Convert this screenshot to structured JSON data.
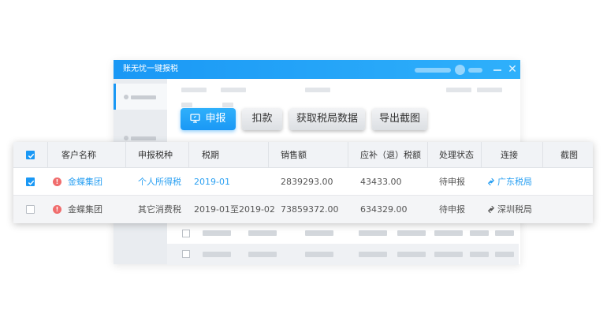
{
  "window": {
    "title": "账无忧一键报税"
  },
  "toolbar": {
    "declare_label": "申报",
    "deduct_label": "扣款",
    "fetch_label": "获取税局数据",
    "export_label": "导出截图"
  },
  "table": {
    "columns": {
      "customer": "客户名称",
      "tax_type": "申报税种",
      "period": "税期",
      "sales": "销售额",
      "payable": "应补（退）税额",
      "status": "处理状态",
      "link": "连接",
      "screenshot": "截图"
    },
    "rows": [
      {
        "checked": true,
        "customer": "金蝶集团",
        "tax_type": "个人所得税",
        "period": "2019-01",
        "sales": "2839293.00",
        "payable": "43433.00",
        "status": "待申报",
        "link": "广东税局"
      },
      {
        "checked": false,
        "customer": "金蝶集团",
        "tax_type": "其它消费税",
        "period": "2019-01至2019-02",
        "sales": "73859372.00",
        "payable": "634329.00",
        "status": "待申报",
        "link": "深圳税局"
      }
    ]
  },
  "colors": {
    "accent": "#1a98f5",
    "link_blue": "#2aa0f2",
    "warning": "#f06d6d"
  },
  "icons": [
    "minimize-icon",
    "close-icon",
    "monitor-icon",
    "check-icon",
    "warning-icon",
    "link-icon"
  ]
}
